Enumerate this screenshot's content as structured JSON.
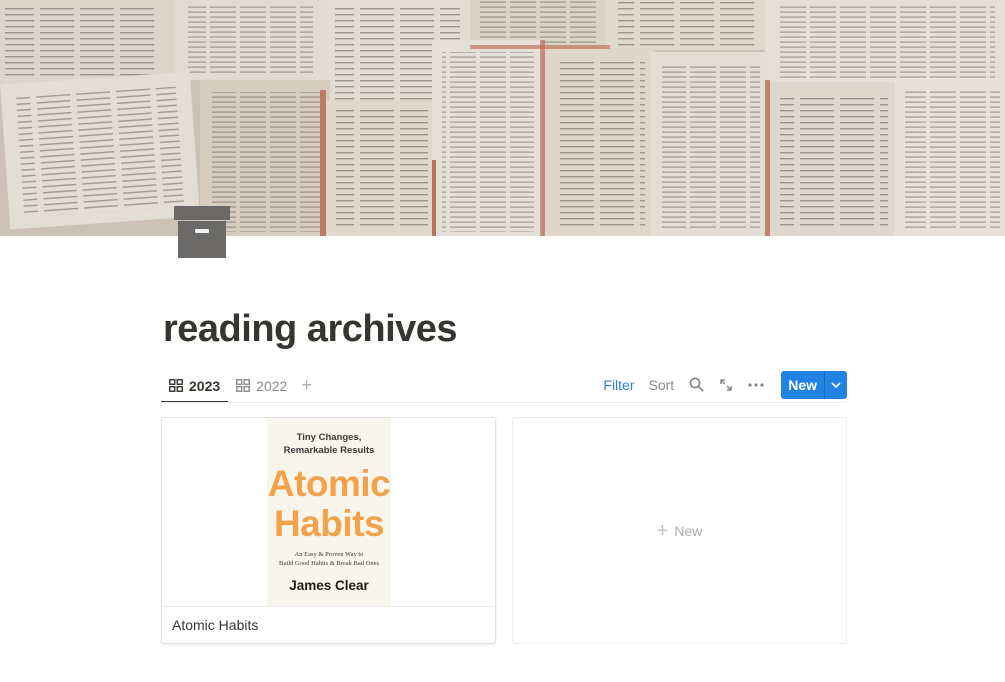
{
  "page": {
    "title": "reading archives",
    "icon": "archive-box-icon",
    "cover": "open-books-collage"
  },
  "view_bar": {
    "tabs": [
      {
        "label": "2023",
        "icon": "gallery-icon",
        "active": true
      },
      {
        "label": "2022",
        "icon": "gallery-icon",
        "active": false
      }
    ],
    "add_view": "+",
    "filter_label": "Filter",
    "sort_label": "Sort",
    "search_icon": "search-icon",
    "expand_icon": "expand-icon",
    "more_icon": "more-icon",
    "new_label": "New",
    "new_caret_icon": "chevron-down-icon"
  },
  "gallery": {
    "cards": [
      {
        "name": "Atomic Habits",
        "cover": {
          "subtitle": "Tiny Changes,\nRemarkable Results",
          "title": "Atomic\nHabits",
          "tagline": "An Easy & Proven Way to\nBuild Good Habits & Break Bad Ones",
          "author": "James Clear"
        }
      }
    ],
    "new_card_label": "New"
  },
  "colors": {
    "accent": "#2383e2",
    "filter_text": "#2f83d6",
    "book_title": "#f2a24a",
    "text": "#37352f"
  }
}
